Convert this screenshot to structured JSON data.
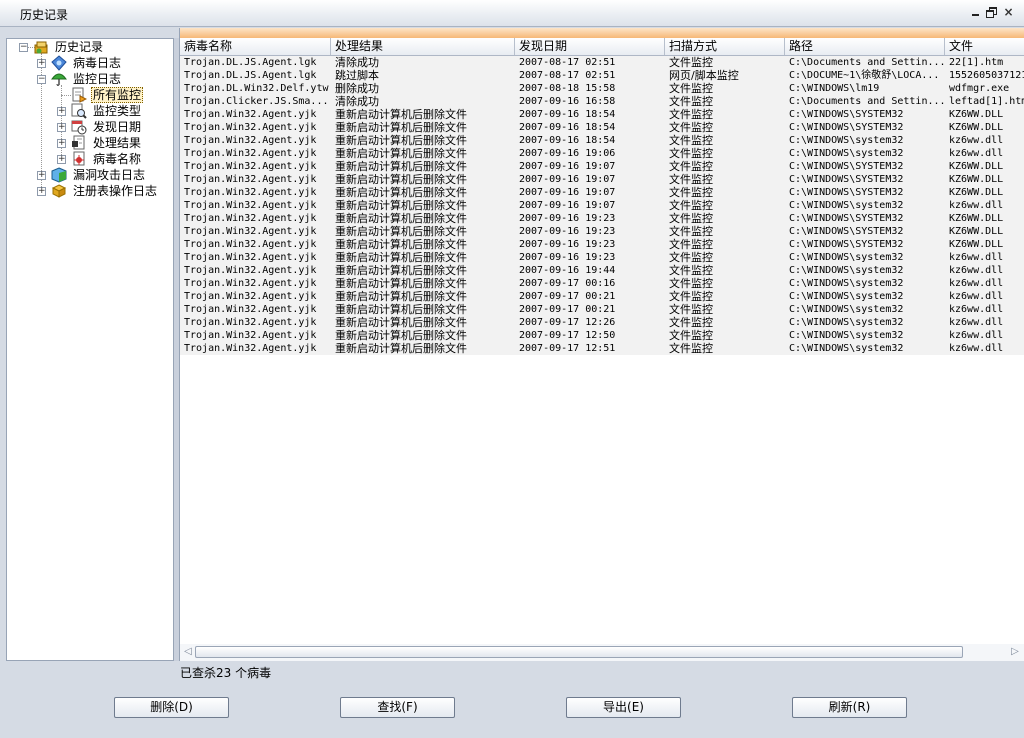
{
  "window": {
    "title": "历史记录",
    "controls": {
      "minimize": "",
      "restore": "",
      "close": "×"
    }
  },
  "tree": {
    "root": {
      "label": "历史记录",
      "expander": "−"
    },
    "virus_log": {
      "label": "病毒日志",
      "expander": "+"
    },
    "monitor_log": {
      "label": "监控日志",
      "expander": "−",
      "children": [
        {
          "label": "所有监控",
          "selected": true
        },
        {
          "label": "监控类型",
          "expander": "+"
        },
        {
          "label": "发现日期",
          "expander": "+"
        },
        {
          "label": "处理结果",
          "expander": "+"
        },
        {
          "label": "病毒名称",
          "expander": "+"
        }
      ]
    },
    "exploit_log": {
      "label": "漏洞攻击日志",
      "expander": "+"
    },
    "registry_log": {
      "label": "注册表操作日志",
      "expander": "+"
    }
  },
  "table": {
    "columns": [
      "病毒名称",
      "处理结果",
      "发现日期",
      "扫描方式",
      "路径",
      "文件"
    ],
    "rows": [
      [
        "Trojan.DL.JS.Agent.lgk",
        "清除成功",
        "2007-08-17 02:51",
        "文件监控",
        "C:\\Documents and Settin...",
        "22[1].htm"
      ],
      [
        "Trojan.DL.JS.Agent.lgk",
        "跳过脚本",
        "2007-08-17 02:51",
        "网页/脚本监控",
        "C:\\DOCUME~1\\徐敬舒\\LOCA...",
        "1552605037121"
      ],
      [
        "Trojan.DL.Win32.Delf.ytw",
        "删除成功",
        "2007-08-18 15:58",
        "文件监控",
        "C:\\WINDOWS\\lm19",
        "wdfmgr.exe"
      ],
      [
        "Trojan.Clicker.JS.Sma...",
        "清除成功",
        "2007-09-16 16:58",
        "文件监控",
        "C:\\Documents and Settin...",
        "leftad[1].htm"
      ],
      [
        "Trojan.Win32.Agent.yjk",
        "重新启动计算机后删除文件",
        "2007-09-16 18:54",
        "文件监控",
        "C:\\WINDOWS\\SYSTEM32",
        "KZ6WW.DLL"
      ],
      [
        "Trojan.Win32.Agent.yjk",
        "重新启动计算机后删除文件",
        "2007-09-16 18:54",
        "文件监控",
        "C:\\WINDOWS\\SYSTEM32",
        "KZ6WW.DLL"
      ],
      [
        "Trojan.Win32.Agent.yjk",
        "重新启动计算机后删除文件",
        "2007-09-16 18:54",
        "文件监控",
        "C:\\WINDOWS\\system32",
        "kz6ww.dll"
      ],
      [
        "Trojan.Win32.Agent.yjk",
        "重新启动计算机后删除文件",
        "2007-09-16 19:06",
        "文件监控",
        "C:\\WINDOWS\\system32",
        "kz6ww.dll"
      ],
      [
        "Trojan.Win32.Agent.yjk",
        "重新启动计算机后删除文件",
        "2007-09-16 19:07",
        "文件监控",
        "C:\\WINDOWS\\SYSTEM32",
        "KZ6WW.DLL"
      ],
      [
        "Trojan.Win32.Agent.yjk",
        "重新启动计算机后删除文件",
        "2007-09-16 19:07",
        "文件监控",
        "C:\\WINDOWS\\SYSTEM32",
        "KZ6WW.DLL"
      ],
      [
        "Trojan.Win32.Agent.yjk",
        "重新启动计算机后删除文件",
        "2007-09-16 19:07",
        "文件监控",
        "C:\\WINDOWS\\SYSTEM32",
        "KZ6WW.DLL"
      ],
      [
        "Trojan.Win32.Agent.yjk",
        "重新启动计算机后删除文件",
        "2007-09-16 19:07",
        "文件监控",
        "C:\\WINDOWS\\system32",
        "kz6ww.dll"
      ],
      [
        "Trojan.Win32.Agent.yjk",
        "重新启动计算机后删除文件",
        "2007-09-16 19:23",
        "文件监控",
        "C:\\WINDOWS\\SYSTEM32",
        "KZ6WW.DLL"
      ],
      [
        "Trojan.Win32.Agent.yjk",
        "重新启动计算机后删除文件",
        "2007-09-16 19:23",
        "文件监控",
        "C:\\WINDOWS\\SYSTEM32",
        "KZ6WW.DLL"
      ],
      [
        "Trojan.Win32.Agent.yjk",
        "重新启动计算机后删除文件",
        "2007-09-16 19:23",
        "文件监控",
        "C:\\WINDOWS\\SYSTEM32",
        "KZ6WW.DLL"
      ],
      [
        "Trojan.Win32.Agent.yjk",
        "重新启动计算机后删除文件",
        "2007-09-16 19:23",
        "文件监控",
        "C:\\WINDOWS\\system32",
        "kz6ww.dll"
      ],
      [
        "Trojan.Win32.Agent.yjk",
        "重新启动计算机后删除文件",
        "2007-09-16 19:44",
        "文件监控",
        "C:\\WINDOWS\\system32",
        "kz6ww.dll"
      ],
      [
        "Trojan.Win32.Agent.yjk",
        "重新启动计算机后删除文件",
        "2007-09-17 00:16",
        "文件监控",
        "C:\\WINDOWS\\system32",
        "kz6ww.dll"
      ],
      [
        "Trojan.Win32.Agent.yjk",
        "重新启动计算机后删除文件",
        "2007-09-17 00:21",
        "文件监控",
        "C:\\WINDOWS\\system32",
        "kz6ww.dll"
      ],
      [
        "Trojan.Win32.Agent.yjk",
        "重新启动计算机后删除文件",
        "2007-09-17 00:21",
        "文件监控",
        "C:\\WINDOWS\\system32",
        "kz6ww.dll"
      ],
      [
        "Trojan.Win32.Agent.yjk",
        "重新启动计算机后删除文件",
        "2007-09-17 12:26",
        "文件监控",
        "C:\\WINDOWS\\system32",
        "kz6ww.dll"
      ],
      [
        "Trojan.Win32.Agent.yjk",
        "重新启动计算机后删除文件",
        "2007-09-17 12:50",
        "文件监控",
        "C:\\WINDOWS\\system32",
        "kz6ww.dll"
      ],
      [
        "Trojan.Win32.Agent.yjk",
        "重新启动计算机后删除文件",
        "2007-09-17 12:51",
        "文件监控",
        "C:\\WINDOWS\\system32",
        "kz6ww.dll"
      ]
    ]
  },
  "scrollbar": {
    "left_arrow": "◁",
    "right_arrow": "▷"
  },
  "status": "已查杀23 个病毒",
  "buttons": {
    "delete": "删除(D)",
    "find": "查找(F)",
    "export": "导出(E)",
    "refresh": "刷新(R)"
  },
  "colors": {
    "accent_strip": "#f6b877",
    "selected_bg": "#fff2c8",
    "row_bg": "#f2f2f2"
  }
}
